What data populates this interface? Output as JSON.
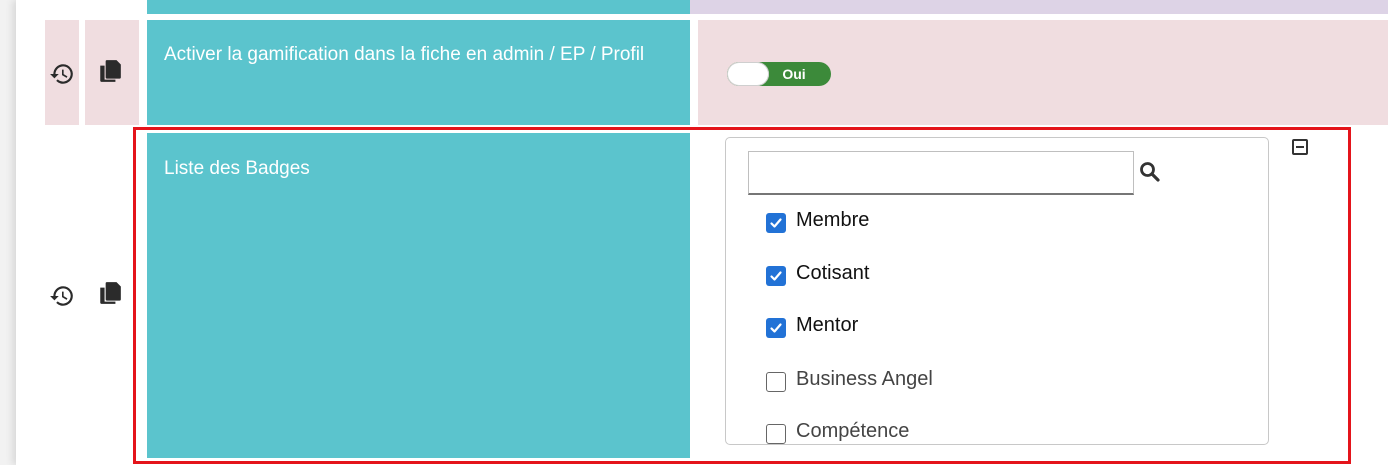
{
  "row_gamification": {
    "label": "Activer la gamification dans la fiche en admin / EP / Profil",
    "toggle_text": "Oui"
  },
  "row_badges": {
    "label": "Liste des Badges",
    "search": {
      "value": "",
      "placeholder": ""
    },
    "options": [
      {
        "label": "Membre",
        "checked": true
      },
      {
        "label": "Cotisant",
        "checked": true
      },
      {
        "label": "Mentor",
        "checked": true
      },
      {
        "label": "Business Angel",
        "checked": false
      },
      {
        "label": "Compétence",
        "checked": false
      }
    ]
  },
  "icons": {
    "history": "history-icon",
    "copy": "copy-icon",
    "search": "search-icon",
    "collapse": "collapse-icon"
  },
  "colors": {
    "teal": "#5bc4cd",
    "pink": "#f0dde0",
    "highlight_border": "#e4141b",
    "toggle_on": "#3c8a3a",
    "checkbox_checked": "#2272d6"
  }
}
